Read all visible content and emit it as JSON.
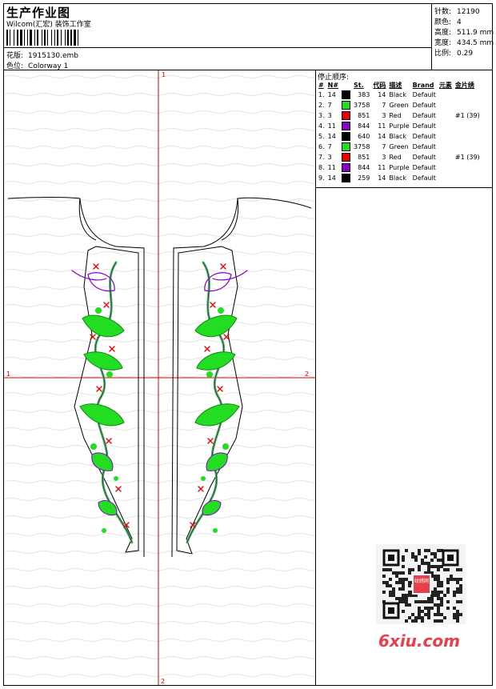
{
  "header": {
    "title": "生产作业图",
    "company": "Wilcom(汇宏) 装饰工作室",
    "design_label": "花版:",
    "design_value": "1915130.emb",
    "colorway_label": "色位:",
    "colorway_value": "Colorway 1"
  },
  "stats": [
    {
      "key": "针数:",
      "value": "12190"
    },
    {
      "key": "颜色:",
      "value": "4"
    },
    {
      "key": "高度:",
      "value": "511.9 mm"
    },
    {
      "key": "宽度:",
      "value": "434.5 mm"
    },
    {
      "key": "比例:",
      "value": "0.29"
    }
  ],
  "axes": {
    "top": "1",
    "left": "1",
    "right": "2",
    "bottom": "2"
  },
  "stop_sequence": {
    "title": "停止顺序:",
    "headers": [
      "#",
      "N#",
      "St.",
      "代码",
      "描述",
      "Brand",
      "元素",
      "金片绣"
    ],
    "rows": [
      {
        "idx": "1.",
        "needle": "14",
        "color": "#000000",
        "stitches": "383",
        "code": "14",
        "desc": "Black",
        "brand": "Default",
        "element": "",
        "sequin": ""
      },
      {
        "idx": "2.",
        "needle": "7",
        "color": "#22dd22",
        "stitches": "3758",
        "code": "7",
        "desc": "Green",
        "brand": "Default",
        "element": "",
        "sequin": ""
      },
      {
        "idx": "3.",
        "needle": "3",
        "color": "#ee0000",
        "stitches": "851",
        "code": "3",
        "desc": "Red",
        "brand": "Default",
        "element": "",
        "sequin": "#1 (39)"
      },
      {
        "idx": "4.",
        "needle": "11",
        "color": "#8800cc",
        "stitches": "844",
        "code": "11",
        "desc": "Purple",
        "brand": "Default",
        "element": "",
        "sequin": ""
      },
      {
        "idx": "5.",
        "needle": "14",
        "color": "#000000",
        "stitches": "640",
        "code": "14",
        "desc": "Black",
        "brand": "Default",
        "element": "",
        "sequin": ""
      },
      {
        "idx": "6.",
        "needle": "7",
        "color": "#22dd22",
        "stitches": "3758",
        "code": "7",
        "desc": "Green",
        "brand": "Default",
        "element": "",
        "sequin": ""
      },
      {
        "idx": "7.",
        "needle": "3",
        "color": "#ee0000",
        "stitches": "851",
        "code": "3",
        "desc": "Red",
        "brand": "Default",
        "element": "",
        "sequin": "#1 (39)"
      },
      {
        "idx": "8.",
        "needle": "11",
        "color": "#8800cc",
        "stitches": "844",
        "code": "11",
        "desc": "Purple",
        "brand": "Default",
        "element": "",
        "sequin": ""
      },
      {
        "idx": "9.",
        "needle": "14",
        "color": "#000000",
        "stitches": "259",
        "code": "14",
        "desc": "Black",
        "brand": "Default",
        "element": "",
        "sequin": ""
      }
    ]
  },
  "watermark": {
    "text": "6xiu.com",
    "qr_badge": "纹绣网",
    "color": "#e8404a"
  },
  "colors": {
    "axis": "#dd0000",
    "outline": "#000000"
  }
}
